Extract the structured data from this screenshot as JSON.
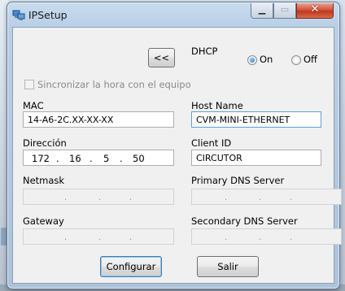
{
  "window": {
    "title": "IPSetup",
    "colors": {
      "accent": "#3c7fb1",
      "close": "#c2371d"
    }
  },
  "controls": {
    "collapse_button": "<<",
    "dhcp_label": "DHCP",
    "dhcp_on": "On",
    "dhcp_off": "Off",
    "dhcp_selected": "On",
    "sync_checkbox": "Sincronizar la hora con el equipo",
    "sync_checked": false
  },
  "fields": {
    "mac_label": "MAC",
    "mac_value": "14-A6-2C.XX-XX-XX",
    "hostname_label": "Host Name",
    "hostname_value": "CVM-MINI-ETHERNET",
    "direccion_label": "Dirección",
    "direccion_octets": [
      "172",
      "16",
      "5",
      "50"
    ],
    "clientid_label": "Client ID",
    "clientid_value": "CIRCUTOR",
    "netmask_label": "Netmask",
    "primary_dns_label": "Primary DNS Server",
    "gateway_label": "Gateway",
    "secondary_dns_label": "Secondary DNS Server"
  },
  "buttons": {
    "configure": "Configurar",
    "exit": "Salir"
  }
}
